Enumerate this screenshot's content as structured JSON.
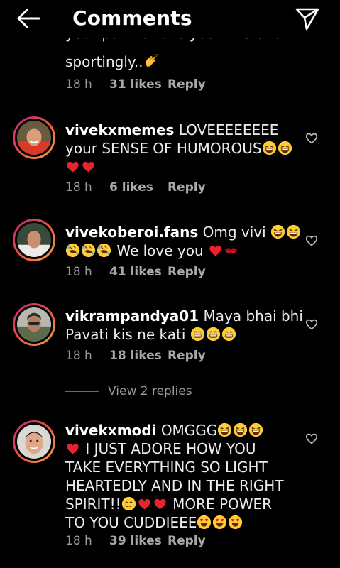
{
  "header": {
    "title": "Comments",
    "back_icon": "arrow-left-icon",
    "share_icon": "send-icon"
  },
  "previous_comment": {
    "cut_text": "your part to take your mistake",
    "text": "sportingly..",
    "time": "18 h",
    "likes": "31 likes",
    "reply": "Reply"
  },
  "comments": [
    {
      "username": "vivekxmemes",
      "line1": "LOVEEEEEEEE",
      "line2": "your SENSE OF HUMOROUS",
      "time": "18 h",
      "likes": "6 likes",
      "reply": "Reply"
    },
    {
      "username": "vivekoberoi.fans",
      "line1": "Omg vivi",
      "line2": "We love you",
      "time": "18 h",
      "likes": "41 likes",
      "reply": "Reply"
    },
    {
      "username": "vikrampandya01",
      "line1": "Maya bhai bhi",
      "line2": "Pavati kis ne kati",
      "time": "18 h",
      "likes": "18 likes",
      "reply": "Reply"
    },
    {
      "username": "vivekxmodi",
      "line1": "OMGGG",
      "line2": "I JUST ADORE HOW YOU",
      "line3": "TAKE EVERYTHING SO LIGHT",
      "line4": "HEARTEDLY AND IN THE RIGHT",
      "line5": "SPIRIT!!",
      "line5b": "MORE POWER",
      "line6": "TO YOU CUDDIEEE",
      "time": "18 h",
      "likes": "39 likes",
      "reply": "Reply"
    }
  ],
  "view_replies": "View 2 replies",
  "colors": {
    "background": "#000000",
    "text": "#ececec",
    "muted": "#9a9a9a",
    "heart": "#ff3040",
    "ring_start": "#b81f7a",
    "ring_end": "#f2a64a"
  },
  "icons": {
    "heart_outline": "heart-outline-icon",
    "laughing_emoji": "laughing-emoji",
    "grinning_emoji": "grinning-emoji",
    "rolling_laughing_emoji": "rolling-laughing-emoji",
    "crying_emoji": "crying-emoji",
    "heart_eyes_emoji": "heart-eyes-emoji",
    "red_heart_emoji": "red-heart-emoji",
    "kiss_emoji": "kiss-mark-emoji",
    "clapping_emoji": "clapping-hands-emoji"
  }
}
